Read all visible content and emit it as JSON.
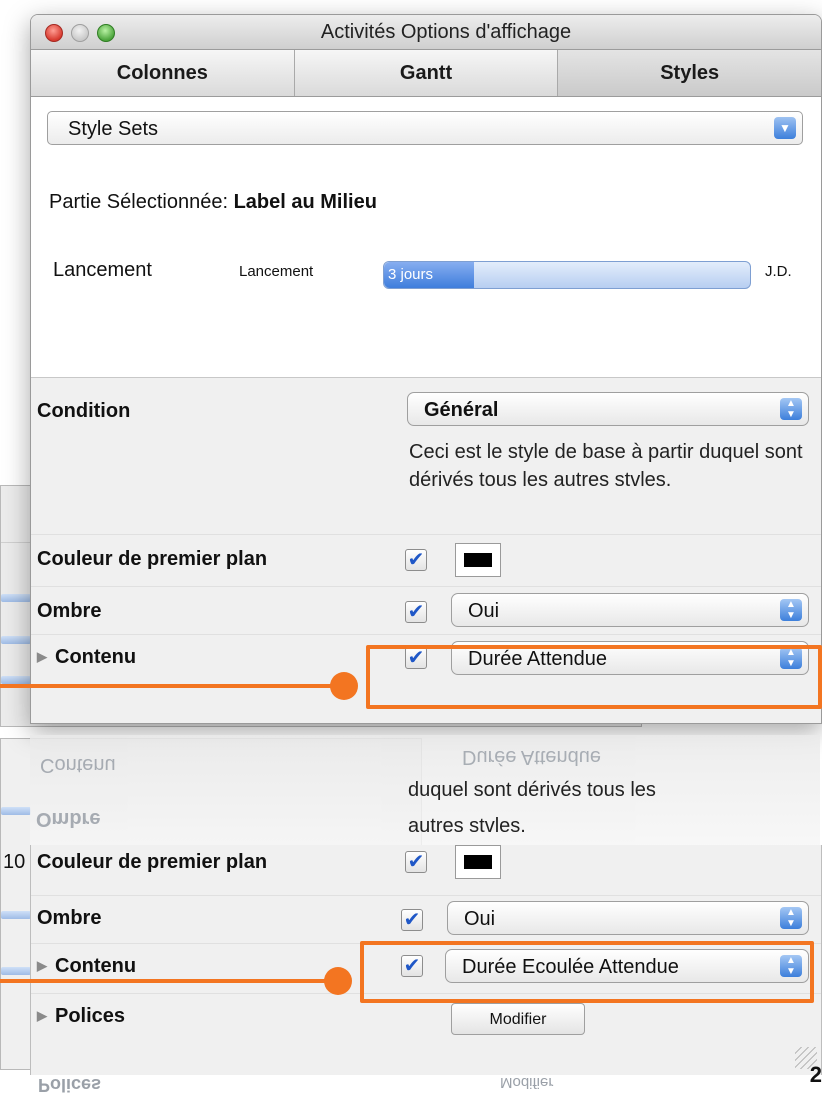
{
  "window": {
    "title": "Activités Options d'affichage",
    "tabs": [
      {
        "label": "Colonnes"
      },
      {
        "label": "Gantt"
      },
      {
        "label": "Styles"
      }
    ],
    "active_tab": "Styles"
  },
  "style_sets": {
    "value": "Style Sets"
  },
  "selected_part": {
    "prefix": "Partie Sélectionnée:",
    "value": "Label au Milieu"
  },
  "preview": {
    "label_left": "Lancement",
    "label_small": "Lancement",
    "bar_text": "3 jours",
    "label_end": "J.D."
  },
  "properties_top": {
    "condition": {
      "label": "Condition",
      "value": "Général"
    },
    "description": "Ceci est le style de base à partir duquel sont dérivés tous les autres stvles.",
    "foreground": {
      "label": "Couleur de premier plan",
      "checked": true,
      "color": "#000000"
    },
    "shadow": {
      "label": "Ombre",
      "checked": true,
      "value": "Oui"
    },
    "content": {
      "label": "Contenu",
      "checked": true,
      "value": "Durée Attendue"
    }
  },
  "reflection_top": {
    "content_label": "Contenu",
    "content_value": "Durée Attendue",
    "shadow_label": "Ombre"
  },
  "properties_bottom": {
    "description_tail": "duquel sont dérivés tous les",
    "description_tail2": "autres stvles.",
    "foreground": {
      "label": "Couleur de premier plan",
      "checked": true,
      "color": "#000000"
    },
    "shadow": {
      "label": "Ombre",
      "checked": true,
      "value": "Oui"
    },
    "content": {
      "label": "Contenu",
      "checked": true,
      "value": "Durée Ecoulée Attendue"
    },
    "fonts": {
      "label": "Polices",
      "button": "Modifier"
    }
  },
  "reflection_bottom": {
    "fonts_label": "Polices",
    "button": "Modifier"
  },
  "background_window_text": {
    "left_digit": "10"
  },
  "page_number": "2",
  "colors": {
    "accent": "#f37521",
    "selection_blue": "#3d7fdb"
  }
}
